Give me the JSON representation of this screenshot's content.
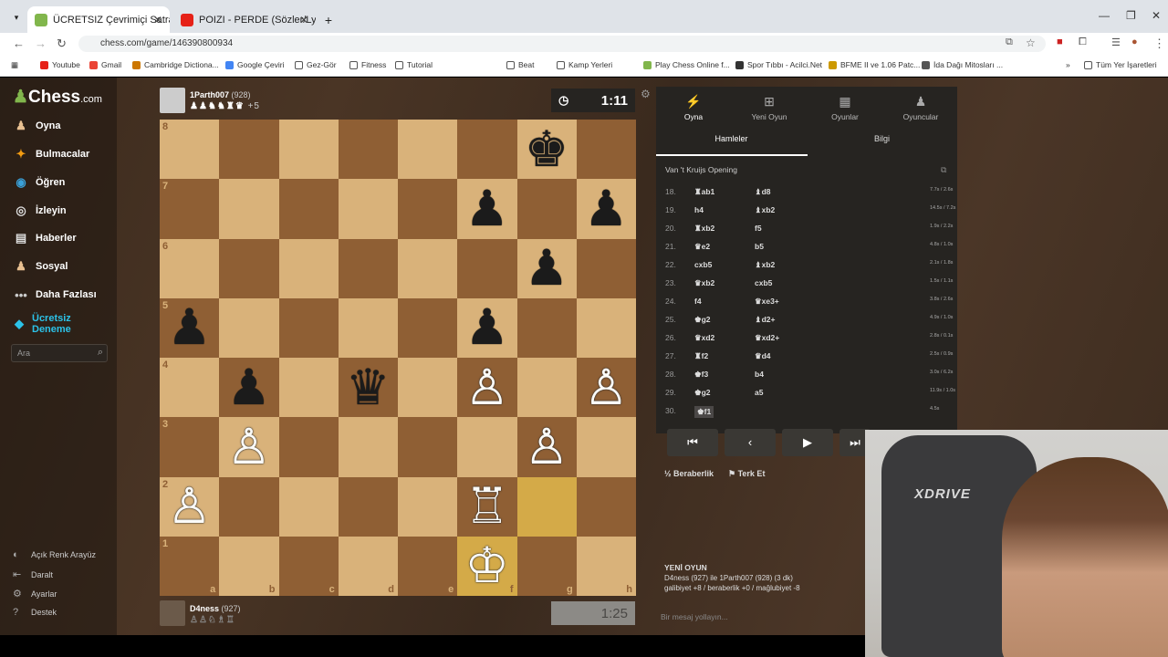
{
  "browser": {
    "tabs": [
      {
        "label": "ÜCRETSIZ Çevrimiçi Satranç Oy"
      },
      {
        "label": "POIZI - PERDE (Sözler/Lyric"
      }
    ],
    "url": "chess.com/game/146390800934",
    "bookmarks": [
      "Youtube",
      "Gmail",
      "Cambridge Dictiona...",
      "Google Çeviri",
      "Gez-Gör",
      "Fitness",
      "Tutorial",
      "Beat",
      "Kamp Yerleri",
      "Play Chess Online f...",
      "Spor Tıbbı - Acilci.Net",
      "BFME II ve 1.06 Patc...",
      "İda Dağı Mitosları ...",
      "Tüm Yer İşaretleri"
    ]
  },
  "sidebar": {
    "logo": "Chess",
    "logo_suffix": ".com",
    "items": [
      {
        "label": "Oyna",
        "icon": "pawn-icon"
      },
      {
        "label": "Bulmacalar",
        "icon": "puzzle-icon"
      },
      {
        "label": "Öğren",
        "icon": "learn-icon"
      },
      {
        "label": "İzleyin",
        "icon": "watch-icon"
      },
      {
        "label": "Haberler",
        "icon": "news-icon"
      },
      {
        "label": "Sosyal",
        "icon": "social-icon"
      },
      {
        "label": "Daha Fazlası",
        "icon": "more-icon"
      },
      {
        "label": "Ücretsiz Deneme",
        "icon": "diamond-icon"
      }
    ],
    "search_placeholder": "Ara",
    "bottom": [
      "Açık Renk Arayüz",
      "Daralt",
      "Ayarlar",
      "Destek"
    ]
  },
  "top_player": {
    "name": "1Parth007",
    "rating": "(928)",
    "captures": "+5",
    "clock": "1:11"
  },
  "bottom_player": {
    "name": "D4ness",
    "rating": "(927)",
    "clock": "1:25"
  },
  "board": {
    "ranks": [
      "8",
      "7",
      "6",
      "5",
      "4",
      "3",
      "2",
      "1"
    ],
    "files": [
      "a",
      "b",
      "c",
      "d",
      "e",
      "f",
      "g",
      "h"
    ],
    "pieces": [
      {
        "sq": "g8",
        "p": "♚",
        "c": "b"
      },
      {
        "sq": "f7",
        "p": "♟",
        "c": "b"
      },
      {
        "sq": "h7",
        "p": "♟",
        "c": "b"
      },
      {
        "sq": "g6",
        "p": "♟",
        "c": "b"
      },
      {
        "sq": "a5",
        "p": "♟",
        "c": "b"
      },
      {
        "sq": "f5",
        "p": "♟",
        "c": "b"
      },
      {
        "sq": "b4",
        "p": "♟",
        "c": "b"
      },
      {
        "sq": "d4",
        "p": "♛",
        "c": "b"
      },
      {
        "sq": "f4",
        "p": "♙",
        "c": "w"
      },
      {
        "sq": "h4",
        "p": "♙",
        "c": "w"
      },
      {
        "sq": "b3",
        "p": "♙",
        "c": "w"
      },
      {
        "sq": "g3",
        "p": "♙",
        "c": "w"
      },
      {
        "sq": "a2",
        "p": "♙",
        "c": "w"
      },
      {
        "sq": "f2",
        "p": "♖",
        "c": "w"
      },
      {
        "sq": "f1",
        "p": "♔",
        "c": "w"
      }
    ],
    "highlight": [
      "g2",
      "f1"
    ]
  },
  "panel": {
    "tabs": [
      {
        "label": "Oyna",
        "icon": "bolt-icon"
      },
      {
        "label": "Yeni Oyun",
        "icon": "plus-icon"
      },
      {
        "label": "Oyunlar",
        "icon": "board-icon"
      },
      {
        "label": "Oyuncular",
        "icon": "players-icon"
      }
    ],
    "subtabs": [
      "Hamleler",
      "Bilgi"
    ],
    "opening": "Van 't Kruijs Opening",
    "moves": [
      {
        "n": "18.",
        "w": "♜ab1",
        "b": "♝d8",
        "t": "7.7s / 2.6s"
      },
      {
        "n": "19.",
        "w": "h4",
        "b": "♝xb2",
        "t": "14.5s / 7.2s"
      },
      {
        "n": "20.",
        "w": "♜xb2",
        "b": "f5",
        "t": "1.9s / 2.2s"
      },
      {
        "n": "21.",
        "w": "♛e2",
        "b": "b5",
        "t": "4.8s / 1.0s"
      },
      {
        "n": "22.",
        "w": "cxb5",
        "b": "♝xb2",
        "t": "2.1s / 1.8s"
      },
      {
        "n": "23.",
        "w": "♛xb2",
        "b": "cxb5",
        "t": "1.5s / 1.1s"
      },
      {
        "n": "24.",
        "w": "f4",
        "b": "♛xe3+",
        "t": "3.8s / 2.6s"
      },
      {
        "n": "25.",
        "w": "♚g2",
        "b": "♝d2+",
        "t": "4.9s / 1.0s"
      },
      {
        "n": "26.",
        "w": "♛xd2",
        "b": "♛xd2+",
        "t": "2.8s / 0.1s"
      },
      {
        "n": "27.",
        "w": "♜f2",
        "b": "♛d4",
        "t": "2.5s / 0.9s"
      },
      {
        "n": "28.",
        "w": "♚f3",
        "b": "b4",
        "t": "3.0s / 6.2s"
      },
      {
        "n": "29.",
        "w": "♚g2",
        "b": "a5",
        "t": "11.9s / 1.0s"
      },
      {
        "n": "30.",
        "w": "♚f1",
        "b": "",
        "t": "4.5s"
      }
    ],
    "draw": "Beraberlik",
    "resign": "Terk Et",
    "newgame_title": "YENİ OYUN",
    "newgame_line1": "D4ness (927) ile 1Parth007 (928) (3 dk)",
    "newgame_line2": "galibiyet +8 / beraberlik +0 / mağlubiyet -8",
    "chat_placeholder": "Bir mesaj yollayın..."
  },
  "webcam": {
    "chair_brand": "XDRIVE"
  },
  "colors": {
    "light": "#d9b27a",
    "dark": "#8f5f34",
    "highlight": "#d4aa48",
    "panel": "#262421"
  }
}
